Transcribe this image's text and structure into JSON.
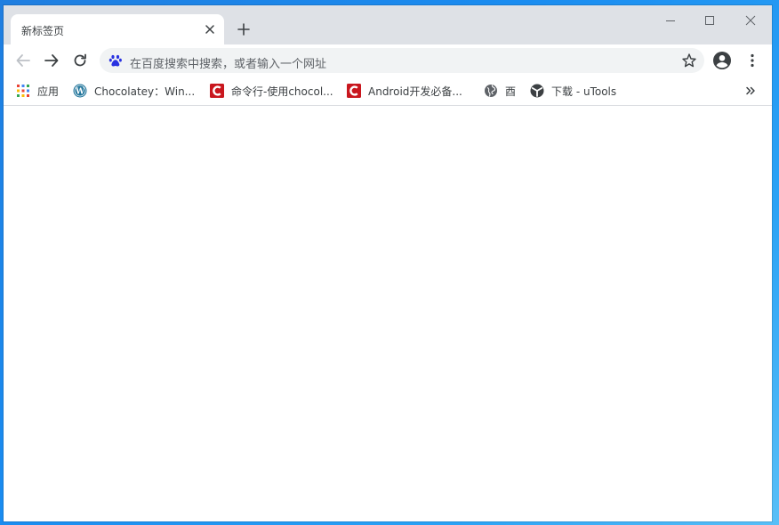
{
  "tab": {
    "title": "新标签页"
  },
  "omnibox": {
    "placeholder": "在百度搜索中搜索，或者输入一个网址"
  },
  "bookmarks": [
    {
      "label": "应用",
      "icon": "apps-grid-icon"
    },
    {
      "label": "Chocolatey：Win...",
      "icon": "wordpress-icon"
    },
    {
      "label": "命令行-使用chocol...",
      "icon": "csdn-icon"
    },
    {
      "label": "Android开发必备...",
      "icon": "csdn-icon"
    },
    {
      "label": "酉",
      "icon": "globe-icon"
    },
    {
      "label": "下载 - uTools",
      "icon": "utools-icon"
    }
  ],
  "colors": {
    "frame": "#dee1e6",
    "omnibox_bg": "#f1f3f4",
    "csdn_red": "#c9171e",
    "wordpress_blue": "#21759b",
    "icon_gray": "#5f6368"
  }
}
